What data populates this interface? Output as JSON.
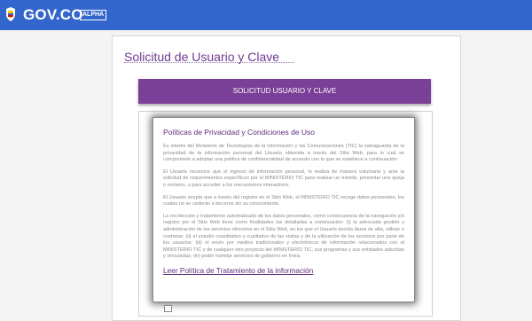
{
  "header": {
    "brand": "GOV.CO",
    "badge": "ALPHA",
    "logo_icon": "colombia-coat-of-arms-icon",
    "background_color": "#3366cc"
  },
  "page": {
    "title": "Solicitud de Usuario y Clave",
    "section_header": "SOLICITUD USUARIO Y CLAVE",
    "accent_color": "#7a3f96"
  },
  "modal": {
    "title": "Políticas de Privacidad y Condiciones de Uso",
    "paragraphs": [
      "Es interés del Ministerio de Tecnologías de la Información y las Comunicaciones (TIC) la salvaguarda de la privacidad de la información personal del Usuario obtenida a través del Sitio Web, para lo cual se compromete a adoptar una política de confidencialidad de acuerdo con lo que se establece a continuación:",
      "El Usuario reconoce que el ingreso de información personal, lo realiza de manera voluntaria y ante la solicitud de requerimientos específicos por el MINISTERIO TIC para realizar un trámite, presentar una queja o reclamo, o para acceder a los mecanismos interactivos.",
      "El Usuario acepta que a través del registro en el Sitio Web, el MINISTERIO TIC recoge datos personales, los cuales no se cederán a terceros sin su conocimiento.",
      "La recolección y tratamiento automatizado de los datos personales, como consecuencia de la navegación y/o registro por el Sitio Web tiene como finalidades las detalladas a continuación: (i) la adecuada gestión y administración de los servicios ofrecidos en el Sitio Web, en los que el Usuario decida darse de alta, utilizar o contratar; (ii) el estudio cuantitativo y cualitativo de las visitas y de la utilización de los servicios por parte de los usuarios; (iii) el envío por medios tradicionales y electrónicos de información relacionados con el MINISTERIO TIC y de cualquier otro proyecto del MINISTERIO TIC, sus programas y sus entidades adscritas y vinculadas; (iv) poder tramitar servicios de gobierno en línea."
    ],
    "link_label": "Leer Política de Tratamiento de la información"
  }
}
